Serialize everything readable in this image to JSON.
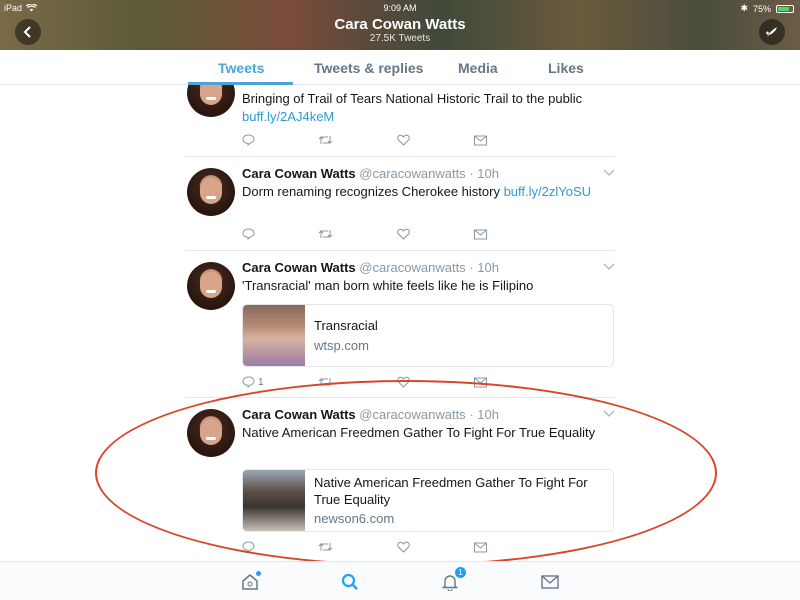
{
  "status_bar": {
    "device": "iPad",
    "time": "9:09 AM",
    "battery": "75%"
  },
  "header": {
    "title": "Cara Cowan Watts",
    "subtitle": "27.5K Tweets"
  },
  "tabs": [
    {
      "label": "Tweets",
      "active": true
    },
    {
      "label": "Tweets & replies",
      "active": false
    },
    {
      "label": "Media",
      "active": false
    },
    {
      "label": "Likes",
      "active": false
    }
  ],
  "tweets": [
    {
      "text": "Bringing of Trail of Tears National Historic Trail to the public ",
      "link": "buff.ly/2AJ4keM"
    },
    {
      "name": "Cara Cowan Watts",
      "handle": "@caracowanwatts",
      "time": "· 10h",
      "text": "Dorm renaming recognizes Cherokee history ",
      "link": "buff.ly/2zlYoSU"
    },
    {
      "name": "Cara Cowan Watts",
      "handle": "@caracowanwatts",
      "time": "· 10h",
      "text": "'Transracial' man born white feels like he is Filipino",
      "card": {
        "title": "Transracial",
        "domain": "wtsp.com"
      },
      "reply_count": "1"
    },
    {
      "name": "Cara Cowan Watts",
      "handle": "@caracowanwatts",
      "time": "· 10h",
      "text": "Native American Freedmen Gather To Fight For True Equality",
      "card": {
        "title": "Native American Freedmen Gather To Fight For True Equality",
        "domain": "newson6.com"
      }
    }
  ],
  "bottom_nav": {
    "notifications_badge": "1"
  },
  "colors": {
    "accent": "#4aa4d6",
    "link": "#2b9bd6",
    "annotation": "#d9452a"
  }
}
